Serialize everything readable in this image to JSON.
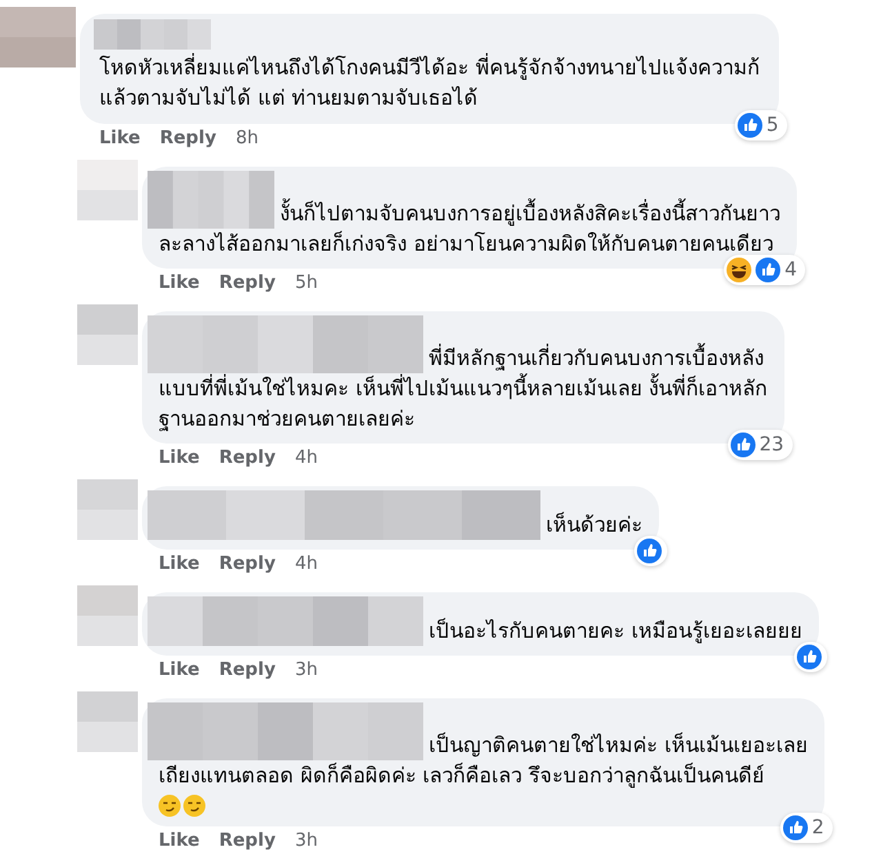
{
  "comments": [
    {
      "lines": [
        "โหดหัวเหลี่ยมแค่ไหนถึงได้โกงคนมีวีได้อะ พี่คนรู้จักจ้างทนายไปแจ้งความก้",
        "แล้วตามจับไม่ได้ แต่ ท่านยมตามจับเธอได้"
      ],
      "like_label": "Like",
      "reply_label": "Reply",
      "time": "8h",
      "reactions": [
        {
          "kind": "like"
        }
      ],
      "reaction_count": "5",
      "replies": [
        {
          "lines": [
            "งั้นก็ไปตามจับคนบงการอยู่เบื้องหลังสิคะเรื่องนี้สาวกันยาว",
            "ละลางไส้ออกมาเลยก็เก่งจริง อย่ามาโยนความผิดให้กับคนตายคนเดียว"
          ],
          "like_label": "Like",
          "reply_label": "Reply",
          "time": "5h",
          "reactions": [
            {
              "kind": "haha"
            },
            {
              "kind": "like"
            }
          ],
          "reaction_count": "4"
        },
        {
          "lines": [
            "พี่มีหลักฐานเกี่ยวกับคนบงการเบื้องหลัง",
            "แบบที่พี่เม้นใช่ไหมคะ เห็นพี่ไปเม้นแนวๆนี้หลายเม้นเลย งั้นพี่ก็เอาหลัก",
            "ฐานออกมาช่วยคนตายเลยค่ะ"
          ],
          "like_label": "Like",
          "reply_label": "Reply",
          "time": "4h",
          "reactions": [
            {
              "kind": "like"
            }
          ],
          "reaction_count": "23"
        },
        {
          "lines": [
            "เห็นด้วยค่ะ"
          ],
          "like_label": "Like",
          "reply_label": "Reply",
          "time": "4h",
          "reactions": [
            {
              "kind": "like"
            }
          ]
        },
        {
          "lines": [
            "เป็นอะไรกับคนตายคะ เหมือนรู้เยอะเลยยย"
          ],
          "like_label": "Like",
          "reply_label": "Reply",
          "time": "3h",
          "reactions": [
            {
              "kind": "like"
            }
          ]
        },
        {
          "lines": [
            "เป็นญาติคนตายใช่ไหมค่ะ เห็นเม้นเยอะเลย",
            "เถียงแทนตลอด ผิดก็คือผิดค่ะ เลวก็คือเลว รึจะบอกว่าลูกฉันเป็นคนดีย์"
          ],
          "emojis": [
            {
              "kind": "smirk"
            },
            {
              "kind": "smirk"
            }
          ],
          "like_label": "Like",
          "reply_label": "Reply",
          "time": "3h",
          "reactions": [
            {
              "kind": "like"
            }
          ],
          "reaction_count": "2"
        }
      ]
    }
  ]
}
